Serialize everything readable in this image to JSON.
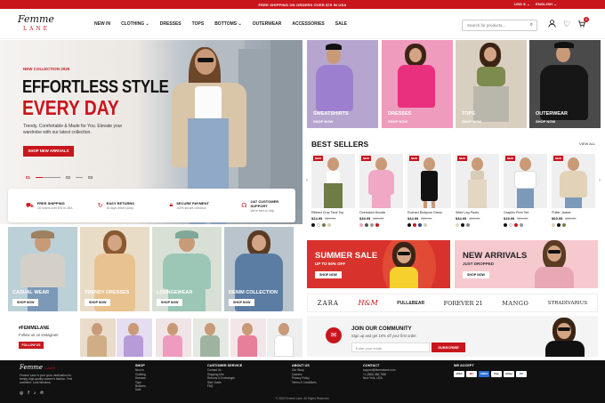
{
  "topbar": {
    "promo": "FREE SHIPPING ON ORDERS OVER $75 IN USA",
    "currency": "USD $ ⌄",
    "language": "ENGLISH ⌄"
  },
  "brand": {
    "line1": "Femme",
    "line2": "LANE",
    "accent": "#c8161d"
  },
  "nav": [
    "NEW IN",
    "CLOTHING ⌄",
    "DRESSES",
    "TOPS",
    "BOTTOMS ⌄",
    "OUTERWEAR",
    "ACCESSORIES",
    "SALE"
  ],
  "search": {
    "placeholder": "Search for products..."
  },
  "cart_count": "0",
  "hero": {
    "kicker": "NEW COLLECTION 2025",
    "title1": "EFFORTLESS STYLE",
    "title2": "EVERY DAY",
    "subtitle": "Trendy, Comfortable & Made for You. Elevate your wardrobe with our latest collection.",
    "cta": "SHOP NEW ARRIVALS",
    "slides": [
      "01",
      "02",
      "03"
    ]
  },
  "features": [
    {
      "icon": "truck-icon",
      "title": "FREE SHIPPING",
      "sub": "On orders over $75 in USA"
    },
    {
      "icon": "return-icon",
      "title": "EASY RETURNS",
      "sub": "30 days return policy"
    },
    {
      "icon": "lock-icon",
      "title": "SECURE PAYMENT",
      "sub": "100% secure checkout"
    },
    {
      "icon": "headset-icon",
      "title": "24/7 CUSTOMER SUPPORT",
      "sub": "We're here to help"
    }
  ],
  "top_categories": [
    {
      "label": "SWEATSHIRTS",
      "cta": "SHOP NOW"
    },
    {
      "label": "DRESSES",
      "cta": "SHOP NOW"
    },
    {
      "label": "TOPS",
      "cta": "SHOP NOW"
    },
    {
      "label": "OUTERWEAR",
      "cta": "SHOP NOW"
    }
  ],
  "bestsellers": {
    "title": "BEST SELLERS",
    "view_all": "VIEW ALL",
    "badge": "NEW",
    "items": [
      {
        "name": "Ribbed Crop Tank Top",
        "price": "$24.99",
        "old": "$29.99"
      },
      {
        "name": "Oversized Hoodie",
        "price": "$39.99",
        "old": "$49.99"
      },
      {
        "name": "Ruched Bodycon Dress",
        "price": "$44.99",
        "old": "$59.99"
      },
      {
        "name": "Wide Leg Pants",
        "price": "$34.99",
        "old": "$44.99"
      },
      {
        "name": "Graphic Print Tee",
        "price": "$19.99",
        "old": "$24.99"
      },
      {
        "name": "Puffer Jacket",
        "price": "$69.99",
        "old": "$89.99"
      }
    ]
  },
  "banners": {
    "sale_title": "SUMMER SALE",
    "sale_sub": "UP TO 50% OFF",
    "sale_cta": "SHOP NOW",
    "new_title": "NEW ARRIVALS",
    "new_sub": "JUST DROPPED",
    "new_cta": "SHOP NOW"
  },
  "brands": [
    "ZARA",
    "H&M",
    "PULL&BEAR",
    "FOREVER 21",
    "MANGO",
    "STRADIVARIUS"
  ],
  "community": {
    "title": "JOIN OUR COMMUNITY",
    "sub": "Sign up and get 10% off your first order.",
    "placeholder": "Enter your email",
    "cta": "SUBSCRIBE"
  },
  "bottom_categories": [
    {
      "label": "CASUAL WEAR",
      "cta": "SHOP NOW"
    },
    {
      "label": "TRENDY DRESSES",
      "cta": "SHOP NOW"
    },
    {
      "label": "LOUNGEWEAR",
      "cta": "SHOP NOW"
    },
    {
      "label": "DENIM COLLECTION",
      "cta": "SHOP NOW"
    }
  ],
  "instagram": {
    "tag": "#FEMMELANE",
    "sub": "Follow us on Instagram",
    "cta": "FOLLOW US"
  },
  "footer": {
    "about": "Femme Lane is your go-to destination for trendy, high-quality women's fashion. Feel confident. Look fabulous.",
    "shop": {
      "title": "SHOP",
      "links": [
        "New In",
        "Clothing",
        "Dresses",
        "Tops",
        "Bottoms",
        "Sale"
      ]
    },
    "service": {
      "title": "CUSTOMER SERVICE",
      "links": [
        "Contact Us",
        "Shipping Info",
        "Returns & Exchanges",
        "Size Guide",
        "FAQ"
      ]
    },
    "about_us": {
      "title": "ABOUT US",
      "links": [
        "Our Story",
        "Careers",
        "Privacy Policy",
        "Terms & Conditions"
      ]
    },
    "contact": {
      "title": "CONTACT",
      "lines": [
        "support@femmelane.com",
        "+1 (555) 456-7890",
        "New York, USA"
      ]
    },
    "accept": {
      "title": "WE ACCEPT",
      "cards": [
        "VISA",
        "MC",
        "AMEX",
        "Pay",
        "GPay",
        "PP"
      ]
    },
    "copyright": "© 2025 Femme Lane. All Rights Reserved."
  }
}
